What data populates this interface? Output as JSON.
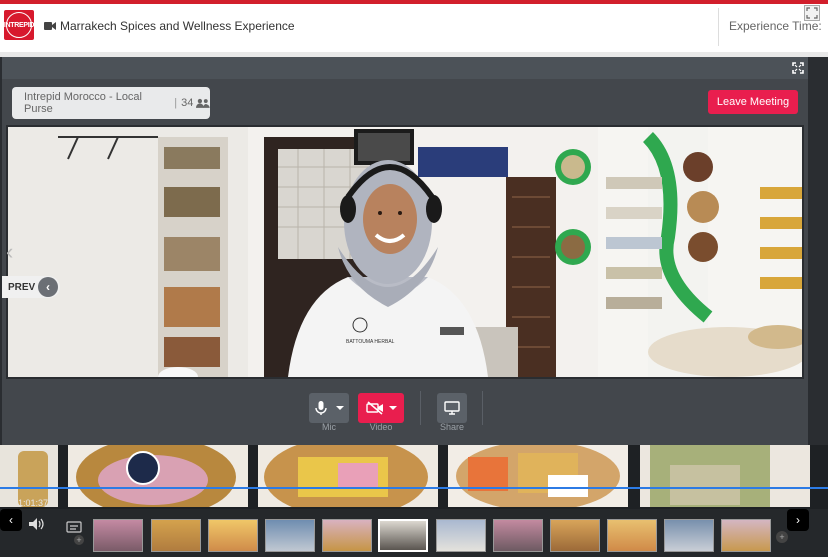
{
  "header": {
    "logo_text": "INTREPID",
    "title": "Marrakech Spices and Wellness Experience",
    "experience_time_label": "Experience Time:"
  },
  "meeting": {
    "room_name": "Intrepid Morocco - Local Purse",
    "participant_count": "34",
    "leave_label": "Leave Meeting",
    "prev_label": "PREV",
    "controls": {
      "mic_label": "Mic",
      "video_label": "Video",
      "share_label": "Share"
    },
    "video_badge_text": "BATTOUMA HERBAL"
  },
  "player": {
    "time_code": "1:01:37"
  },
  "colors": {
    "brand_red": "#d7192d",
    "leave_button": "#e91e4e",
    "video_off_button": "#e91e4e",
    "progress": "#2c7be5"
  },
  "icons": [
    "video-camera-icon",
    "fullscreen-icon",
    "participants-icon",
    "mic-icon",
    "video-off-icon",
    "chevron-down-icon",
    "monitor-share-icon",
    "chevron-left-icon",
    "chevron-right-icon",
    "volume-icon",
    "captions-icon",
    "expand-icon"
  ]
}
